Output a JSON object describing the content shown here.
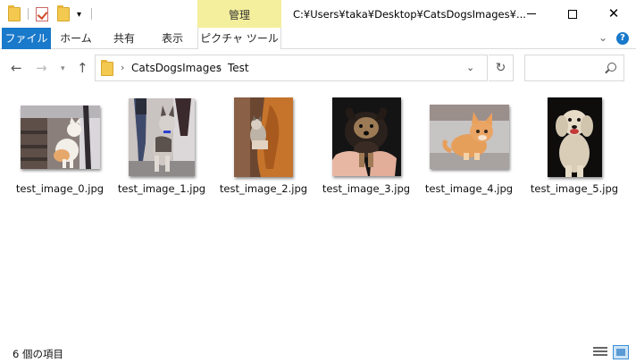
{
  "window": {
    "path_title": "C:¥Users¥taka¥Desktop¥CatsDogsImages¥...",
    "manage_tab": "管理"
  },
  "ribbon": {
    "tabs": [
      "ファイル",
      "ホーム",
      "共有",
      "表示",
      "ピクチャ ツール"
    ]
  },
  "address": {
    "breadcrumbs": [
      "CatsDogsImages",
      "Test"
    ]
  },
  "files": [
    {
      "name": "test_image_0.jpg"
    },
    {
      "name": "test_image_1.jpg"
    },
    {
      "name": "test_image_2.jpg"
    },
    {
      "name": "test_image_3.jpg"
    },
    {
      "name": "test_image_4.jpg"
    },
    {
      "name": "test_image_5.jpg"
    }
  ],
  "status": {
    "item_count": "6 個の項目"
  },
  "colors": {
    "file_tab": "#1979ca",
    "manage_tab": "#f4ef9c"
  }
}
